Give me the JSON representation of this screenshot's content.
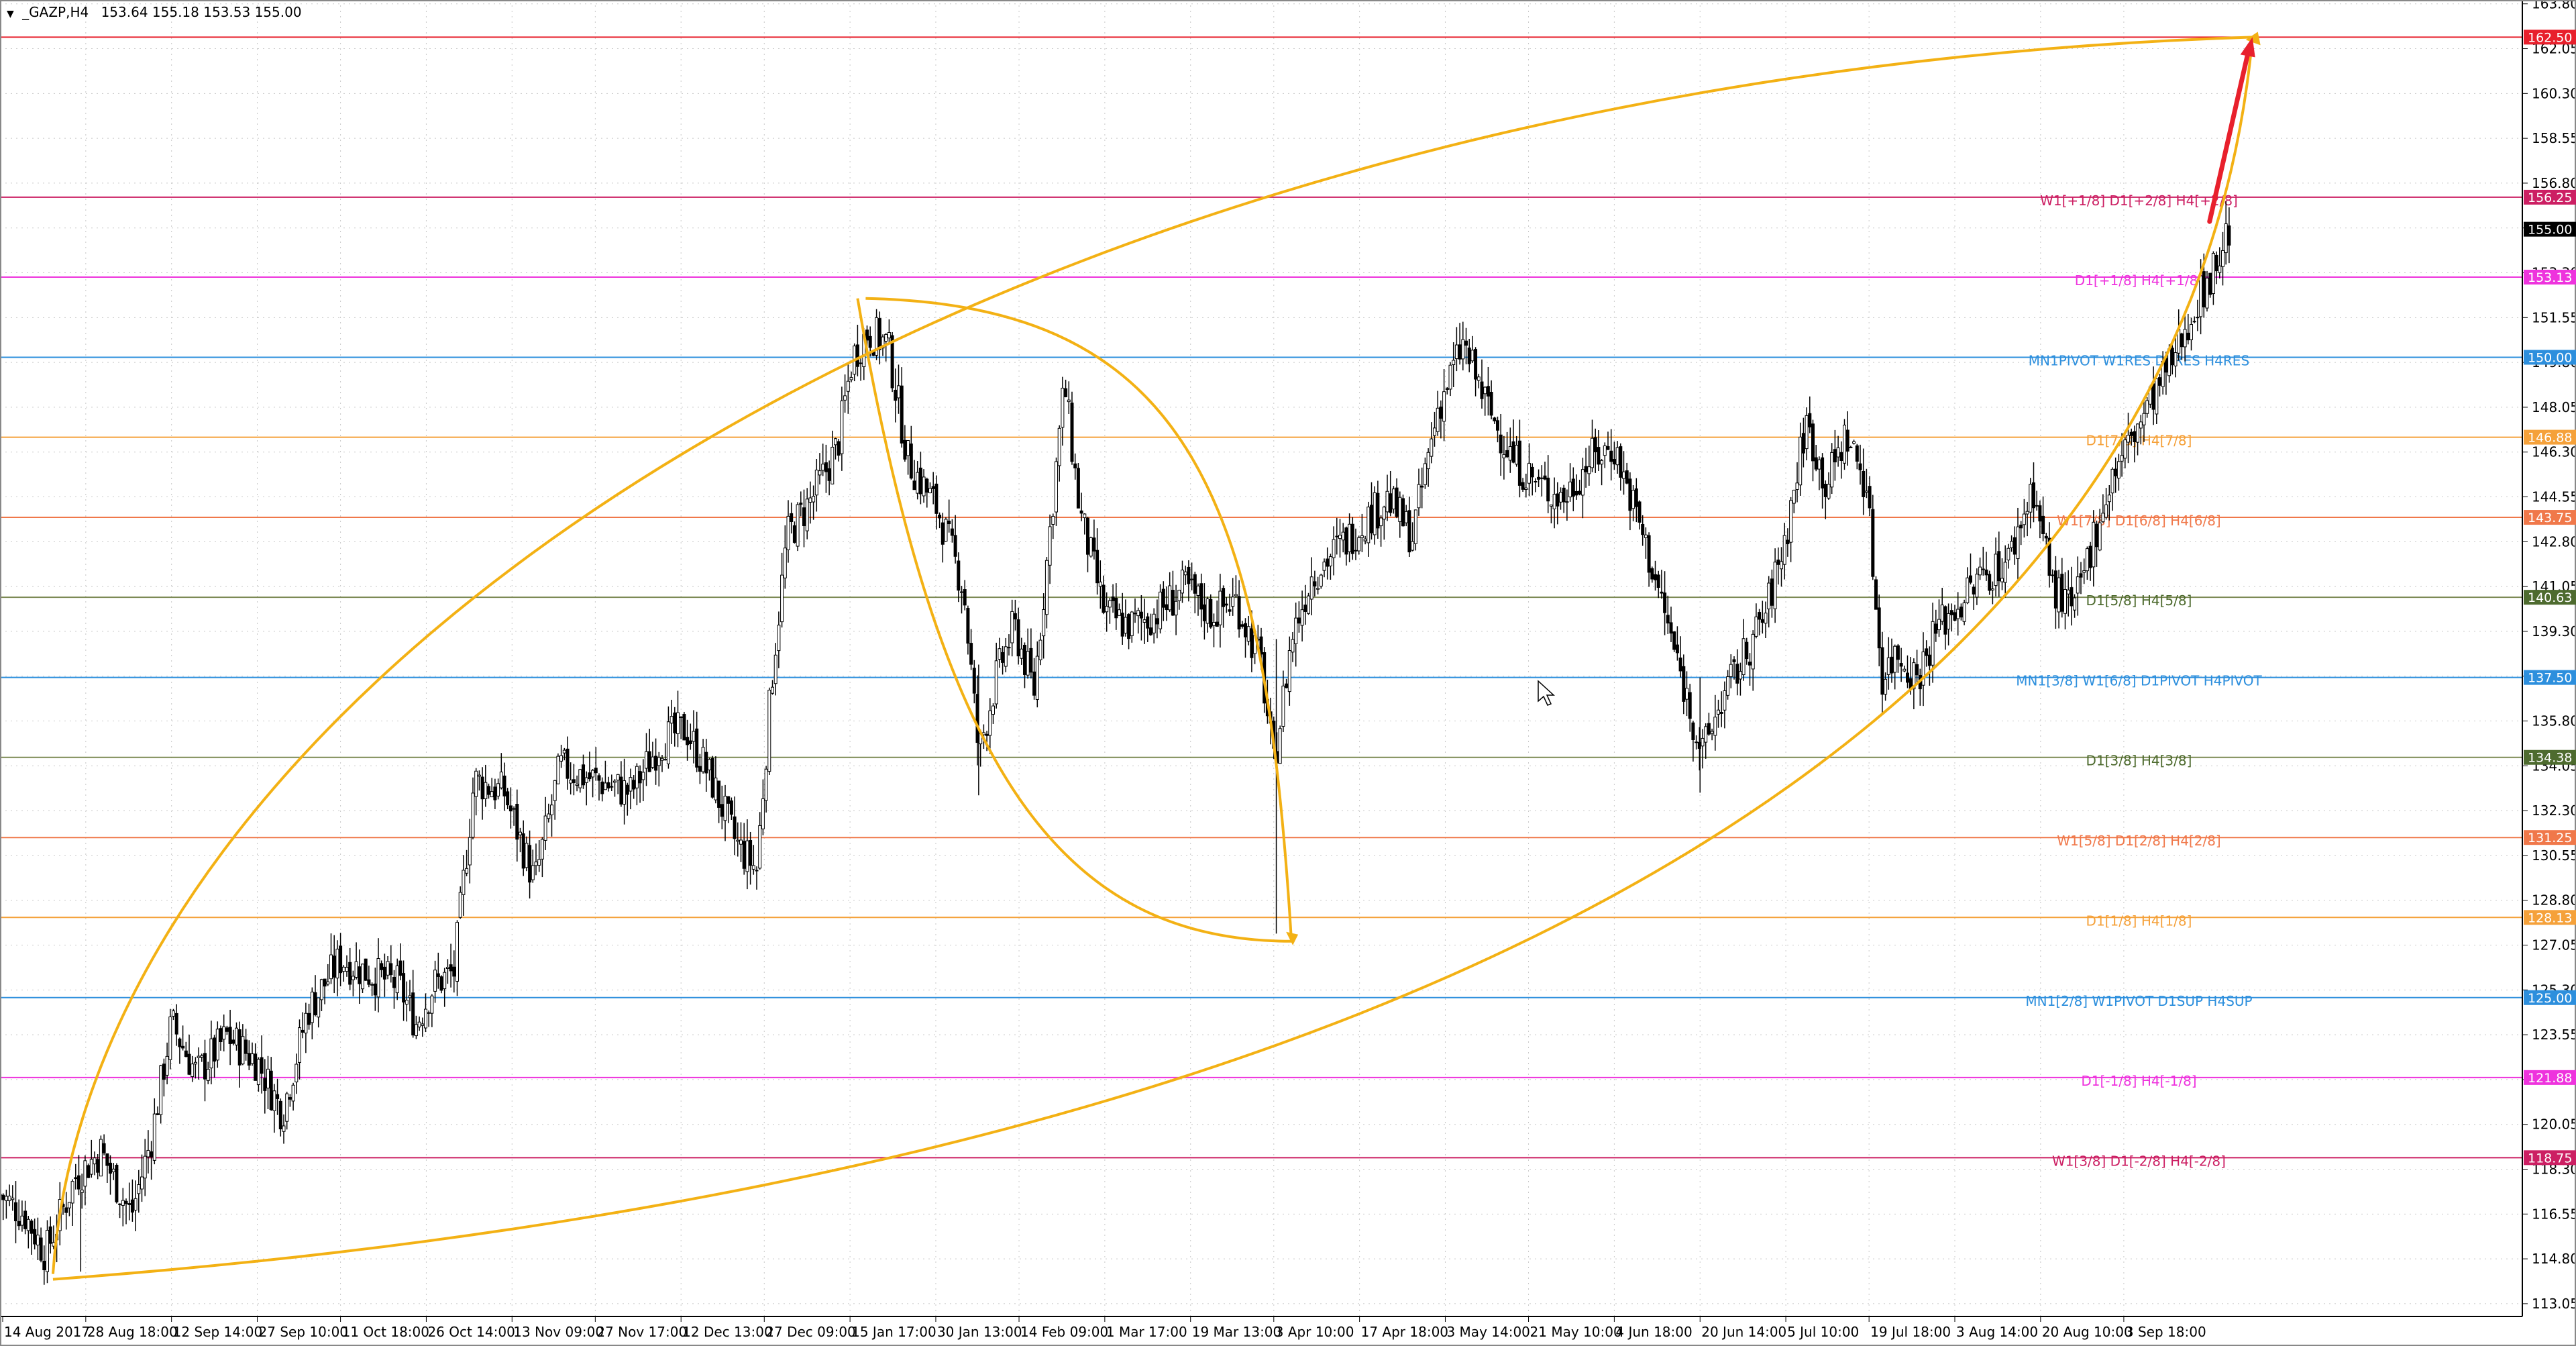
{
  "header": {
    "symbol": "_GAZP,H4",
    "ohlc": "153.64 155.18 153.53 155.00",
    "indicator_icon": "triangle-down-icon"
  },
  "chart_data": {
    "type": "candlestick",
    "title": "_GAZP,H4",
    "ylim": [
      112.55,
      163.95
    ],
    "y_ticks": [
      "163.80",
      "162.05",
      "160.30",
      "158.55",
      "156.80",
      "155.05",
      "153.30",
      "151.55",
      "149.80",
      "148.05",
      "146.30",
      "144.55",
      "142.80",
      "141.05",
      "139.30",
      "137.55",
      "135.80",
      "134.05",
      "132.30",
      "130.55",
      "128.80",
      "127.05",
      "125.30",
      "123.55",
      "121.80",
      "120.05",
      "118.30",
      "116.55",
      "114.80",
      "113.05"
    ],
    "x_ticks": [
      {
        "label": "14 Aug 2017",
        "t": 0
      },
      {
        "label": "28 Aug 18:00",
        "t": 0.034
      },
      {
        "label": "12 Sep 14:00",
        "t": 0.068
      },
      {
        "label": "27 Sep 10:00",
        "t": 0.102
      },
      {
        "label": "11 Oct 18:00",
        "t": 0.135
      },
      {
        "label": "26 Oct 14:00",
        "t": 0.169
      },
      {
        "label": "13 Nov 09:00",
        "t": 0.203
      },
      {
        "label": "27 Nov 17:00",
        "t": 0.236
      },
      {
        "label": "12 Dec 13:00",
        "t": 0.27
      },
      {
        "label": "27 Dec 09:00",
        "t": 0.303
      },
      {
        "label": "15 Jan 17:00",
        "t": 0.337
      },
      {
        "label": "30 Jan 13:00",
        "t": 0.371
      },
      {
        "label": "14 Feb 09:00",
        "t": 0.404
      },
      {
        "label": "1 Mar 17:00",
        "t": 0.438
      },
      {
        "label": "19 Mar 13:00",
        "t": 0.472
      },
      {
        "label": "3 Apr 10:00",
        "t": 0.505
      },
      {
        "label": "17 Apr 18:00",
        "t": 0.539
      },
      {
        "label": "3 May 14:00",
        "t": 0.573
      },
      {
        "label": "21 May 10:00",
        "t": 0.606
      },
      {
        "label": "4 Jun 18:00",
        "t": 0.64
      },
      {
        "label": "20 Jun 14:00",
        "t": 0.674
      },
      {
        "label": "5 Jul 10:00",
        "t": 0.708
      },
      {
        "label": "19 Jul 18:00",
        "t": 0.741
      },
      {
        "label": "3 Aug 14:00",
        "t": 0.775
      },
      {
        "label": "20 Aug 10:00",
        "t": 0.809
      },
      {
        "label": "3 Sep 18:00",
        "t": 0.842
      }
    ],
    "price_path": [
      [
        0.0,
        117.3
      ],
      [
        0.01,
        116.5
      ],
      [
        0.018,
        115.0
      ],
      [
        0.03,
        118.0
      ],
      [
        0.04,
        119.0
      ],
      [
        0.052,
        116.5
      ],
      [
        0.06,
        119.5
      ],
      [
        0.068,
        124.0
      ],
      [
        0.078,
        122.0
      ],
      [
        0.09,
        123.5
      ],
      [
        0.102,
        122.5
      ],
      [
        0.112,
        120.5
      ],
      [
        0.122,
        124.5
      ],
      [
        0.135,
        126.5
      ],
      [
        0.145,
        126.0
      ],
      [
        0.158,
        125.5
      ],
      [
        0.165,
        124.0
      ],
      [
        0.172,
        125.5
      ],
      [
        0.18,
        126.0
      ],
      [
        0.188,
        133.5
      ],
      [
        0.2,
        133.0
      ],
      [
        0.212,
        129.5
      ],
      [
        0.222,
        134.0
      ],
      [
        0.236,
        133.5
      ],
      [
        0.25,
        133.0
      ],
      [
        0.262,
        135.0
      ],
      [
        0.272,
        135.5
      ],
      [
        0.282,
        133.5
      ],
      [
        0.292,
        131.0
      ],
      [
        0.3,
        130.0
      ],
      [
        0.306,
        137.5
      ],
      [
        0.312,
        143.0
      ],
      [
        0.322,
        144.5
      ],
      [
        0.332,
        146.5
      ],
      [
        0.338,
        150.0
      ],
      [
        0.344,
        151.0
      ],
      [
        0.352,
        150.5
      ],
      [
        0.36,
        146.0
      ],
      [
        0.372,
        144.0
      ],
      [
        0.382,
        141.0
      ],
      [
        0.388,
        134.5
      ],
      [
        0.395,
        137.5
      ],
      [
        0.402,
        139.5
      ],
      [
        0.41,
        137.0
      ],
      [
        0.418,
        145.0
      ],
      [
        0.422,
        149.0
      ],
      [
        0.428,
        144.0
      ],
      [
        0.438,
        140.0
      ],
      [
        0.448,
        139.5
      ],
      [
        0.458,
        140.0
      ],
      [
        0.47,
        141.0
      ],
      [
        0.48,
        140.0
      ],
      [
        0.49,
        140.5
      ],
      [
        0.5,
        138.0
      ],
      [
        0.505,
        134.0
      ],
      [
        0.512,
        139.0
      ],
      [
        0.52,
        141.5
      ],
      [
        0.53,
        142.5
      ],
      [
        0.54,
        143.5
      ],
      [
        0.55,
        144.5
      ],
      [
        0.56,
        143.0
      ],
      [
        0.57,
        148.0
      ],
      [
        0.58,
        150.5
      ],
      [
        0.59,
        148.0
      ],
      [
        0.6,
        146.0
      ],
      [
        0.61,
        145.0
      ],
      [
        0.62,
        144.5
      ],
      [
        0.63,
        146.0
      ],
      [
        0.64,
        146.5
      ],
      [
        0.65,
        143.5
      ],
      [
        0.66,
        140.0
      ],
      [
        0.668,
        137.0
      ],
      [
        0.675,
        134.5
      ],
      [
        0.682,
        136.5
      ],
      [
        0.69,
        138.0
      ],
      [
        0.7,
        140.0
      ],
      [
        0.708,
        143.0
      ],
      [
        0.716,
        147.5
      ],
      [
        0.724,
        145.0
      ],
      [
        0.732,
        147.0
      ],
      [
        0.74,
        145.0
      ],
      [
        0.746,
        137.5
      ],
      [
        0.752,
        138.5
      ],
      [
        0.76,
        137.5
      ],
      [
        0.768,
        139.5
      ],
      [
        0.778,
        140.5
      ],
      [
        0.786,
        141.5
      ],
      [
        0.796,
        142.0
      ],
      [
        0.806,
        145.0
      ],
      [
        0.814,
        141.0
      ],
      [
        0.822,
        140.0
      ],
      [
        0.83,
        143.0
      ],
      [
        0.838,
        145.5
      ],
      [
        0.846,
        147.0
      ],
      [
        0.854,
        148.5
      ],
      [
        0.862,
        150.0
      ],
      [
        0.87,
        152.0
      ],
      [
        0.878,
        153.5
      ],
      [
        0.884,
        155.0
      ]
    ],
    "levels": [
      {
        "price": 162.5,
        "badge": "162.50",
        "label": "",
        "color": "#e8202c",
        "text_color": "#e8202c",
        "badge_color": "#e8202c"
      },
      {
        "price": 156.25,
        "badge": "156.25",
        "label": "W1[+1/8] D1[+2/8] H4[+2/8]",
        "color": "#cc1f63",
        "text_color": "#cc1f63",
        "badge_color": "#cc1f63"
      },
      {
        "price": 153.13,
        "badge": "153.13",
        "label": "D1[+1/8] H4[+1/8]",
        "color": "#ee33dd",
        "text_color": "#ee33dd",
        "badge_color": "#ee33dd"
      },
      {
        "price": 150.0,
        "badge": "150.00",
        "label": "MN1PIVOT W1RES D1RES H4RES",
        "color": "#2d8fdd",
        "text_color": "#2d8fdd",
        "badge_color": "#2d8fdd"
      },
      {
        "price": 146.88,
        "badge": "146.88",
        "label": "D1[7/8] H4[7/8]",
        "color": "#f5a13a",
        "text_color": "#f5a13a",
        "badge_color": "#f5a13a"
      },
      {
        "price": 143.75,
        "badge": "143.75",
        "label": "W1[7/8] D1[6/8] H4[6/8]",
        "color": "#f0784a",
        "text_color": "#f0784a",
        "badge_color": "#f0784a"
      },
      {
        "price": 140.63,
        "badge": "140.63",
        "label": "D1[5/8] H4[5/8]",
        "color": "#7d8a55",
        "text_color": "#4e6b2f",
        "badge_color": "#4e6b2f"
      },
      {
        "price": 137.5,
        "badge": "137.50",
        "label": "MN1[3/8] W1[6/8] D1PIVOT H4PIVOT",
        "color": "#2d8fdd",
        "text_color": "#2d8fdd",
        "badge_color": "#2d8fdd"
      },
      {
        "price": 134.38,
        "badge": "134.38",
        "label": "D1[3/8] H4[3/8]",
        "color": "#7d8a55",
        "text_color": "#4e6b2f",
        "badge_color": "#4e6b2f"
      },
      {
        "price": 131.25,
        "badge": "131.25",
        "label": "W1[5/8] D1[2/8] H4[2/8]",
        "color": "#f0784a",
        "text_color": "#f0784a",
        "badge_color": "#f0784a"
      },
      {
        "price": 128.13,
        "badge": "128.13",
        "label": "D1[1/8] H4[1/8]",
        "color": "#f5a13a",
        "text_color": "#f5a13a",
        "badge_color": "#f5a13a"
      },
      {
        "price": 125.0,
        "badge": "125.00",
        "label": "MN1[2/8] W1PIVOT D1SUP H4SUP",
        "color": "#2d8fdd",
        "text_color": "#2d8fdd",
        "badge_color": "#2d8fdd"
      },
      {
        "price": 121.88,
        "badge": "121.88",
        "label": "D1[-1/8] H4[-1/8]",
        "color": "#ee33dd",
        "text_color": "#ee33dd",
        "badge_color": "#ee33dd"
      },
      {
        "price": 118.75,
        "badge": "118.75",
        "label": "W1[3/8] D1[-2/8] H4[-2/8]",
        "color": "#cc1f63",
        "text_color": "#cc1f63",
        "badge_color": "#cc1f63"
      }
    ],
    "current_price": {
      "price": 155.0,
      "badge": "155.00",
      "badge_color": "#000000"
    },
    "annotations": {
      "arc_color": "#f3b114",
      "arrow_color": "#e8202c",
      "big_arc": {
        "start": [
          0.021,
          114.0
        ],
        "end": [
          0.893,
          162.5
        ]
      },
      "inner_arc": {
        "start": [
          0.34,
          152.3
        ],
        "end": [
          0.512,
          127.2
        ]
      },
      "arrow": {
        "from": [
          0.876,
          155.3
        ],
        "to": [
          0.893,
          162.5
        ]
      }
    },
    "grid": true
  }
}
